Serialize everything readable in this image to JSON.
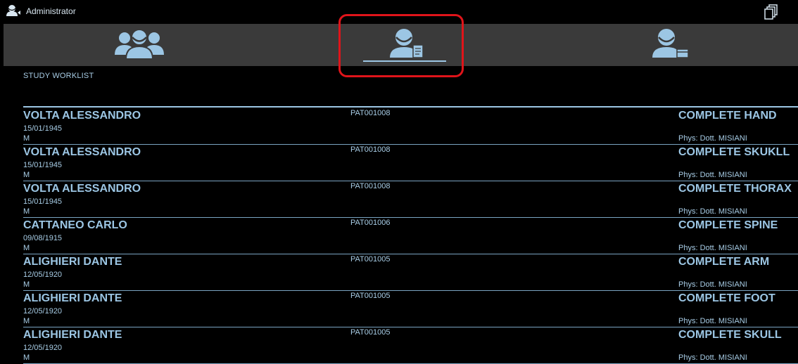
{
  "app": {
    "title": "Administrator"
  },
  "nav": {
    "tabs": [
      {
        "name": "patients-group",
        "icon": "users-group-icon"
      },
      {
        "name": "study-worklist",
        "icon": "patient-document-icon",
        "active": true
      },
      {
        "name": "patient-detail",
        "icon": "patient-card-icon"
      }
    ]
  },
  "section": {
    "title": "STUDY WORKLIST"
  },
  "worklist": [
    {
      "name": "VOLTA ALESSANDRO",
      "dob": "15/01/1945",
      "sex": "M",
      "id": "PAT001008",
      "exam": "COMPLETE HAND",
      "physician": "Phys: Dott. MISIANI"
    },
    {
      "name": "VOLTA ALESSANDRO",
      "dob": "15/01/1945",
      "sex": "M",
      "id": "PAT001008",
      "exam": "COMPLETE SKUKLL",
      "physician": "Phys: Dott. MISIANI"
    },
    {
      "name": "VOLTA ALESSANDRO",
      "dob": "15/01/1945",
      "sex": "M",
      "id": "PAT001008",
      "exam": "COMPLETE THORAX",
      "physician": "Phys: Dott. MISIANI"
    },
    {
      "name": "CATTANEO CARLO",
      "dob": "09/08/1915",
      "sex": "M",
      "id": "PAT001006",
      "exam": "COMPLETE SPINE",
      "physician": "Phys: Dott. MISIANI"
    },
    {
      "name": "ALIGHIERI DANTE",
      "dob": "12/05/1920",
      "sex": "M",
      "id": "PAT001005",
      "exam": "COMPLETE ARM",
      "physician": "Phys: Dott. MISIANI"
    },
    {
      "name": "ALIGHIERI DANTE",
      "dob": "12/05/1920",
      "sex": "M",
      "id": "PAT001005",
      "exam": "COMPLETE FOOT",
      "physician": "Phys: Dott. MISIANI"
    },
    {
      "name": "ALIGHIERI DANTE",
      "dob": "12/05/1920",
      "sex": "M",
      "id": "PAT001005",
      "exam": "COMPLETE SKULL",
      "physician": "Phys: Dott. MISIANI"
    }
  ],
  "colors": {
    "accent": "#9cc6e4",
    "highlight": "#e0141a",
    "navbar": "#3a3a3a",
    "background": "#000000"
  }
}
